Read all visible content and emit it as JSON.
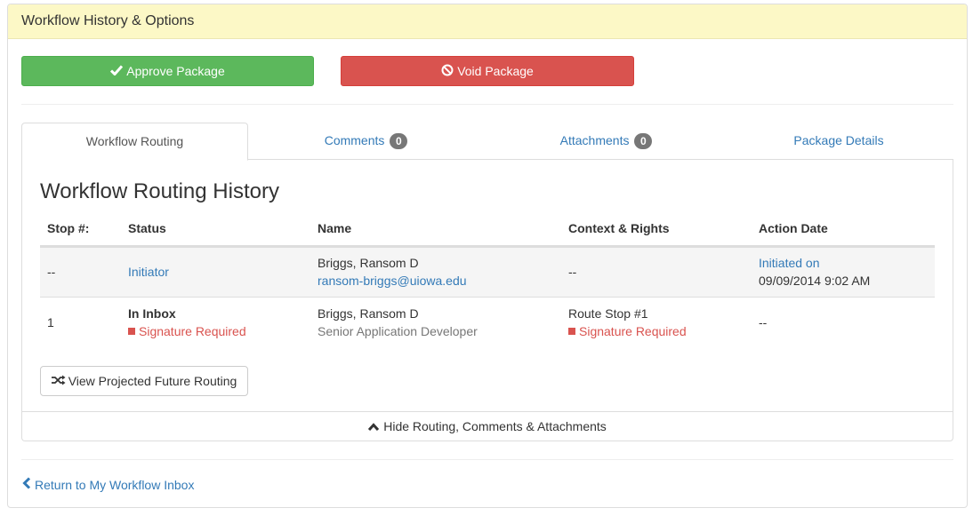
{
  "panel": {
    "title": "Workflow History & Options"
  },
  "actions": {
    "approve_label": "Approve Package",
    "void_label": "Void Package"
  },
  "tabs": [
    {
      "label": "Workflow Routing",
      "active": true
    },
    {
      "label": "Comments",
      "count": "0"
    },
    {
      "label": "Attachments",
      "count": "0"
    },
    {
      "label": "Package Details"
    }
  ],
  "routing": {
    "title": "Workflow Routing History",
    "columns": [
      "Stop #:",
      "Status",
      "Name",
      "Context & Rights",
      "Action Date"
    ],
    "rows": [
      {
        "stop": "--",
        "status": "Initiator",
        "name": "Briggs, Ransom D",
        "name_sub": "ransom-briggs@uiowa.edu",
        "context": "--",
        "action_line1": "Initiated on",
        "action_line2": "09/09/2014 9:02 AM"
      },
      {
        "stop": "1",
        "status": "In Inbox",
        "status_sub": "Signature Required",
        "name": "Briggs, Ransom D",
        "name_sub": "Senior Application Developer",
        "context": "Route Stop #1",
        "context_sub": "Signature Required",
        "action": "--"
      }
    ],
    "future_button": "View Projected Future Routing",
    "hide_label": "Hide Routing, Comments & Attachments"
  },
  "return_link": "Return to My Workflow Inbox",
  "colors": {
    "heading_bg": "#fcf8c6",
    "approve": "#5cb85c",
    "void": "#d9534f",
    "link": "#337ab7",
    "badge": "#777777"
  },
  "icons": [
    "check-icon",
    "ban-icon",
    "random-icon",
    "chevron-up-icon",
    "chevron-left-icon"
  ]
}
